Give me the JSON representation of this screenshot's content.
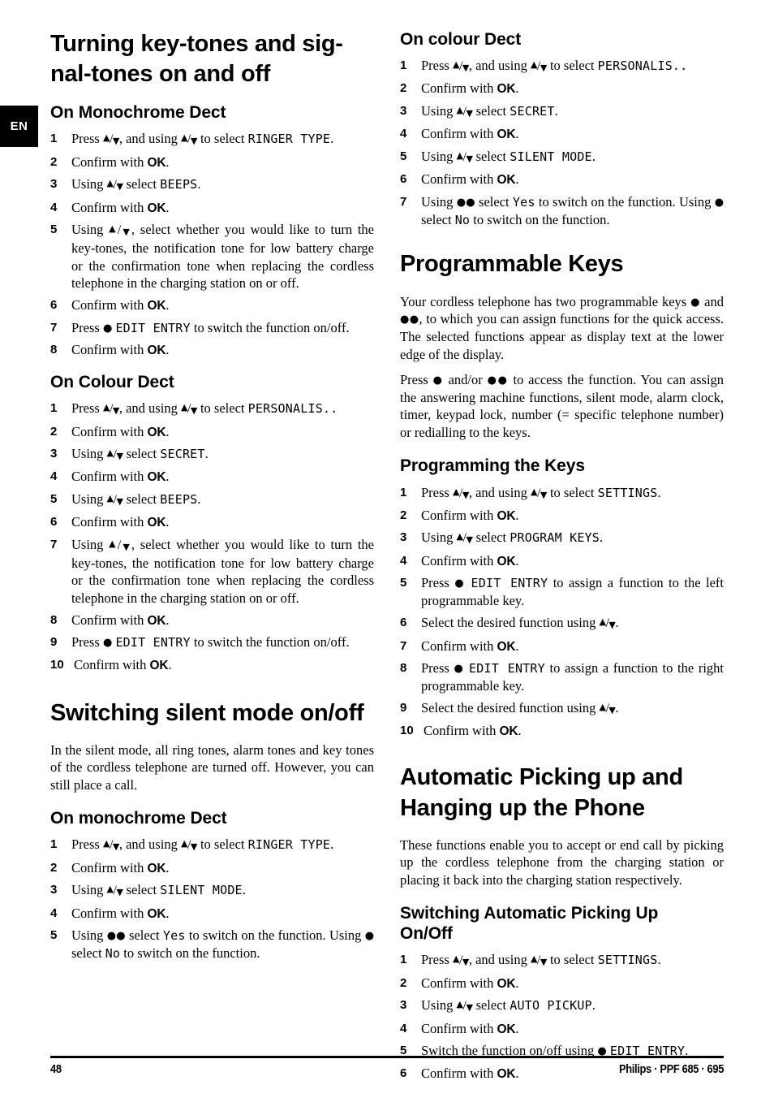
{
  "page": {
    "language_tab": "EN",
    "page_number": "48",
    "product_line": "Philips · PPF 685 · 695"
  },
  "glyphs": {
    "up_down": "▲/▼",
    "key_dot_one": "●",
    "key_dot_two": "●●"
  },
  "left_column": {
    "sections": [
      {
        "title": "Turning key-tones and sig-nal-tones on and off",
        "title_line1": "Turning key-tones and sig-",
        "title_line2": "nal-tones on and off",
        "subsections": [
          {
            "heading": "On Monochrome Dect",
            "steps": [
              {
                "n": "1",
                "text": "Press ▲/▼, and using ▲/▼ to select RINGER TYPE."
              },
              {
                "n": "2",
                "text": "Confirm with OK."
              },
              {
                "n": "3",
                "text": "Using ▲/▼ select BEEPS."
              },
              {
                "n": "4",
                "text": "Confirm with OK."
              },
              {
                "n": "5",
                "text": "Using ▲/▼, select whether you would like to turn the key-tones, the notification tone for low battery charge or the confirmation tone when replacing the cordless telephone in the charging station on or off."
              },
              {
                "n": "6",
                "text": "Confirm with OK."
              },
              {
                "n": "7",
                "text": "Press ● EDIT ENTRY to switch the function on/off."
              },
              {
                "n": "8",
                "text": "Confirm with OK."
              }
            ]
          },
          {
            "heading": "On Colour Dect",
            "steps": [
              {
                "n": "1",
                "text": "Press ▲/▼, and using ▲/▼ to select PERSONALIS.."
              },
              {
                "n": "2",
                "text": "Confirm with OK."
              },
              {
                "n": "3",
                "text": "Using ▲/▼ select SECRET."
              },
              {
                "n": "4",
                "text": "Confirm with OK."
              },
              {
                "n": "5",
                "text": "Using ▲/▼ select BEEPS."
              },
              {
                "n": "6",
                "text": "Confirm with OK."
              },
              {
                "n": "7",
                "text": "Using ▲/▼, select whether you would like to turn the key-tones, the notification tone for low battery charge or the confirmation tone when replacing the cordless telephone in the charging station on or off."
              },
              {
                "n": "8",
                "text": "Confirm with OK."
              },
              {
                "n": "9",
                "text": "Press ● EDIT ENTRY to switch the function on/off."
              },
              {
                "n": "10",
                "text": "Confirm with OK."
              }
            ]
          }
        ]
      },
      {
        "title": "Switching silent mode on/off",
        "intro": "In the silent mode, all ring tones, alarm tones and key tones of the cordless telephone are turned off. However, you can still place a call.",
        "subsections": [
          {
            "heading": "On monochrome Dect",
            "steps": [
              {
                "n": "1",
                "text": "Press ▲/▼, and using ▲/▼ to select RINGER TYPE."
              },
              {
                "n": "2",
                "text": "Confirm with OK."
              },
              {
                "n": "3",
                "text": "Using ▲/▼ select SILENT MODE."
              },
              {
                "n": "4",
                "text": "Confirm with OK."
              },
              {
                "n": "5",
                "text": "Using ●● select Yes to switch on the function. Using ● select No to switch on the function."
              }
            ]
          }
        ]
      }
    ]
  },
  "right_column": {
    "sections": [
      {
        "heading": "On colour Dect",
        "steps": [
          {
            "n": "1",
            "text": "Press ▲/▼, and using ▲/▼ to select PERSONALIS.."
          },
          {
            "n": "2",
            "text": "Confirm with OK."
          },
          {
            "n": "3",
            "text": "Using ▲/▼ select SECRET."
          },
          {
            "n": "4",
            "text": "Confirm with OK."
          },
          {
            "n": "5",
            "text": "Using ▲/▼ select SILENT MODE."
          },
          {
            "n": "6",
            "text": "Confirm with OK."
          },
          {
            "n": "7",
            "text": "Using ●● select Yes to switch on the function. Using ● select No to switch on the function."
          }
        ]
      },
      {
        "title": "Programmable Keys",
        "paragraphs": [
          "Your cordless telephone has two programmable keys ● and ●●, to which you can assign functions for the quick access. The selected functions appear as display text at the lower edge of the display.",
          "Press ● and/or ●● to access the function. You can assign the answering machine functions, silent mode, alarm clock, timer, keypad lock, number (= specific telephone number) or redialling to the keys."
        ],
        "subsections": [
          {
            "heading": "Programming the Keys",
            "steps": [
              {
                "n": "1",
                "text": "Press ▲/▼, and using ▲/▼ to select SETTINGS."
              },
              {
                "n": "2",
                "text": "Confirm with OK."
              },
              {
                "n": "3",
                "text": "Using ▲/▼ select PROGRAM KEYS."
              },
              {
                "n": "4",
                "text": "Confirm with OK."
              },
              {
                "n": "5",
                "text": "Press ● EDIT ENTRY to assign a function to the left programmable key."
              },
              {
                "n": "6",
                "text": "Select the desired function using ▲/▼."
              },
              {
                "n": "7",
                "text": "Confirm with OK."
              },
              {
                "n": "8",
                "text": "Press ● EDIT ENTRY to assign a function to the right programmable key."
              },
              {
                "n": "9",
                "text": "Select the desired function using ▲/▼."
              },
              {
                "n": "10",
                "text": "Confirm with OK."
              }
            ]
          }
        ]
      },
      {
        "title": "Automatic Picking up and Hanging up the Phone",
        "title_line1": "Automatic Picking up and",
        "title_line2": "Hanging up the Phone",
        "intro": "These functions enable you to accept or end call by picking up the cordless telephone from the charging station or placing it back into the charging station respectively.",
        "subsections": [
          {
            "heading": "Switching Automatic Picking Up On/Off",
            "heading_line1": "Switching Automatic Picking Up",
            "heading_line2": "On/Off",
            "steps": [
              {
                "n": "1",
                "text": "Press ▲/▼, and using ▲/▼ to select SETTINGS."
              },
              {
                "n": "2",
                "text": "Confirm with OK."
              },
              {
                "n": "3",
                "text": "Using ▲/▼ select AUTO PICKUP."
              },
              {
                "n": "4",
                "text": " Confirm with OK."
              },
              {
                "n": "5",
                "text": "Switch the function on/off using ● EDIT ENTRY."
              },
              {
                "n": "6",
                "text": "Confirm with OK."
              }
            ]
          }
        ]
      }
    ]
  }
}
